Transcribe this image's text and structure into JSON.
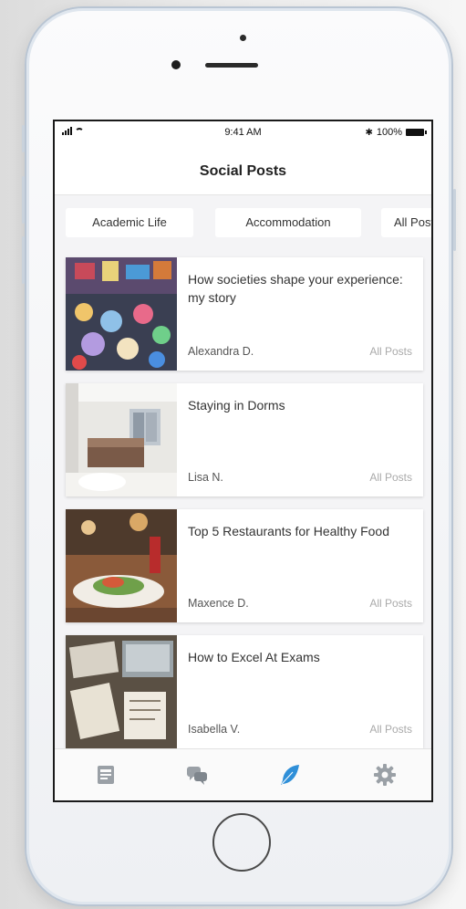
{
  "status": {
    "time": "9:41 AM",
    "battery": "100%"
  },
  "header": {
    "title": "Social Posts"
  },
  "filters": [
    "Academic Life",
    "Accommodation",
    "All Posts"
  ],
  "posts": [
    {
      "title": "How societies shape your experience: my story",
      "author": "Alexandra D.",
      "category": "All Posts"
    },
    {
      "title": "Staying in Dorms",
      "author": "Lisa N.",
      "category": "All Posts"
    },
    {
      "title": "Top 5 Restaurants for Healthy Food",
      "author": "Maxence D.",
      "category": "All Posts"
    },
    {
      "title": "How to Excel At Exams",
      "author": "Isabella V.",
      "category": "All Posts"
    }
  ],
  "tabs": [
    {
      "icon": "newspaper-icon",
      "active": false
    },
    {
      "icon": "chat-bubbles-icon",
      "active": false
    },
    {
      "icon": "feather-icon",
      "active": true
    },
    {
      "icon": "gear-icon",
      "active": false
    }
  ],
  "colors": {
    "accent": "#2f8fd8",
    "inactive_icon": "#9aa0a6",
    "background": "#f4f4f6"
  }
}
